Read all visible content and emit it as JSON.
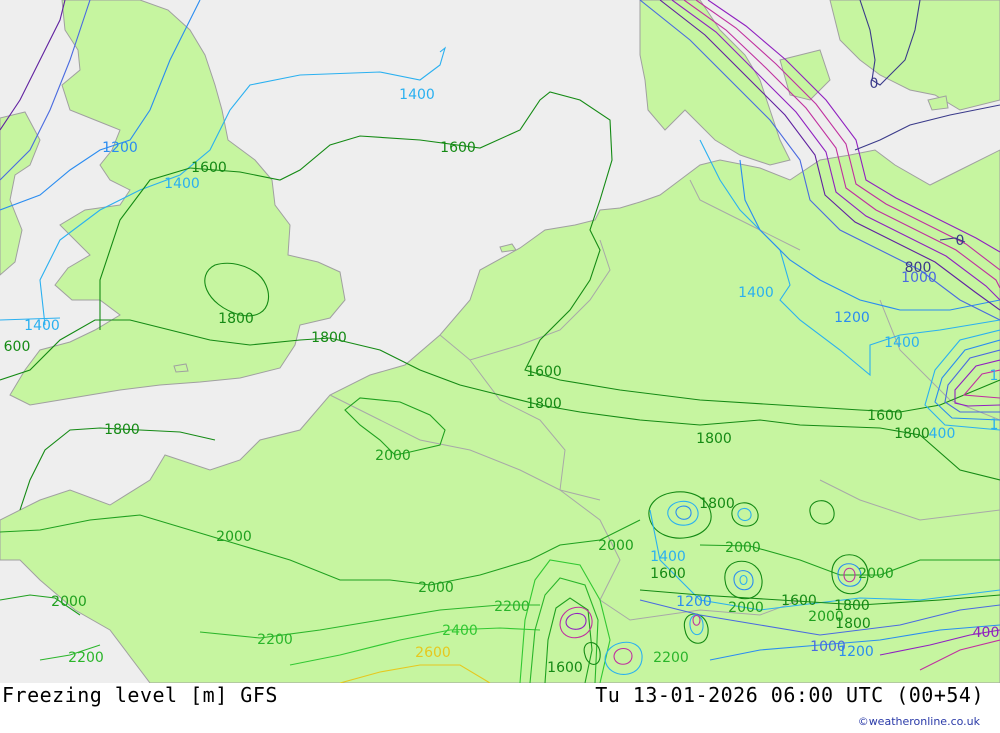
{
  "footer": {
    "title": "Freezing level [m] GFS",
    "datetime": "Tu 13-01-2026 06:00 UTC (00+54)",
    "credit": "©weatheronline.co.uk"
  },
  "colors": {
    "sea": "#eeeeee",
    "land": "#c6f5a0",
    "coastline": "#a0a0a0",
    "contour_1000": "#4a6ae0",
    "contour_1200": "#2a8cf0",
    "contour_1400": "#2ab0f0",
    "contour_1600": "#148a14",
    "contour_1800": "#148a14",
    "contour_2000": "#1fa01f",
    "contour_2200": "#2ab52a",
    "contour_2400": "#32c832",
    "contour_2600": "#e6c81e",
    "contour_low": "#9020c0",
    "contour_0": "#3a3a8a"
  },
  "contour_labels": [
    {
      "id": "l1400-a",
      "text": "1400",
      "color": "#2ab0f0"
    },
    {
      "id": "l1200-a",
      "text": "1200",
      "color": "#2a8cf0"
    },
    {
      "id": "l1400-b",
      "text": "1400",
      "color": "#2ab0f0"
    },
    {
      "id": "l1600-a",
      "text": "1600",
      "color": "#148a14"
    },
    {
      "id": "l1600-b",
      "text": "1600",
      "color": "#148a14"
    },
    {
      "id": "l1800-a",
      "text": "1800",
      "color": "#148a14"
    },
    {
      "id": "l1400-c",
      "text": "1400",
      "color": "#2ab0f0"
    },
    {
      "id": "l600",
      "text": "600",
      "color": "#148a14"
    },
    {
      "id": "l1800-b",
      "text": "1800",
      "color": "#148a14"
    },
    {
      "id": "l1800-c",
      "text": "1800",
      "color": "#148a14"
    },
    {
      "id": "l1600-c",
      "text": "1600",
      "color": "#148a14"
    },
    {
      "id": "l1800-d",
      "text": "1800",
      "color": "#148a14"
    },
    {
      "id": "l2000-a",
      "text": "2000",
      "color": "#1fa01f"
    },
    {
      "id": "l1800-e",
      "text": "1800",
      "color": "#148a14"
    },
    {
      "id": "l1600-d",
      "text": "1600",
      "color": "#148a14"
    },
    {
      "id": "l1800-f",
      "text": "1800",
      "color": "#148a14"
    },
    {
      "id": "l1400-d",
      "text": "1400",
      "color": "#2ab0f0"
    },
    {
      "id": "l1200-b",
      "text": "1200",
      "color": "#2a8cf0"
    },
    {
      "id": "l1400-e",
      "text": "1400",
      "color": "#2ab0f0"
    },
    {
      "id": "l1000",
      "text": "1000",
      "color": "#4a6ae0"
    },
    {
      "id": "l800",
      "text": "800",
      "color": "#3a3a8a"
    },
    {
      "id": "l0-a",
      "text": "0",
      "color": "#3a3a8a"
    },
    {
      "id": "l0-b",
      "text": "0",
      "color": "#3a3a8a"
    },
    {
      "id": "l2000-b",
      "text": "2000",
      "color": "#1fa01f"
    },
    {
      "id": "l2000-c",
      "text": "2000",
      "color": "#1fa01f"
    },
    {
      "id": "l2000-d",
      "text": "2000",
      "color": "#1fa01f"
    },
    {
      "id": "l2000-e",
      "text": "2000",
      "color": "#1fa01f"
    },
    {
      "id": "l1800-g",
      "text": "1800",
      "color": "#148a14"
    },
    {
      "id": "l2000-f",
      "text": "2000",
      "color": "#1fa01f"
    },
    {
      "id": "l1400-f",
      "text": "1400",
      "color": "#2ab0f0"
    },
    {
      "id": "l1600-e",
      "text": "1600",
      "color": "#148a14"
    },
    {
      "id": "l2000-g",
      "text": "2000",
      "color": "#1fa01f"
    },
    {
      "id": "l1200-c",
      "text": "1200",
      "color": "#2a8cf0"
    },
    {
      "id": "l2000-h",
      "text": "2000",
      "color": "#1fa01f"
    },
    {
      "id": "l1600-f",
      "text": "1600",
      "color": "#148a14"
    },
    {
      "id": "l1800-h",
      "text": "1800",
      "color": "#148a14"
    },
    {
      "id": "l2000-i",
      "text": "2000",
      "color": "#1fa01f"
    },
    {
      "id": "l1800-i",
      "text": "1800",
      "color": "#148a14"
    },
    {
      "id": "l2000-j",
      "text": "2000",
      "color": "#1fa01f"
    },
    {
      "id": "l2200-a",
      "text": "2200",
      "color": "#2ab52a"
    },
    {
      "id": "l2000-k",
      "text": "2000",
      "color": "#1fa01f"
    },
    {
      "id": "l2200-b",
      "text": "2200",
      "color": "#2ab52a"
    },
    {
      "id": "l2400",
      "text": "2400",
      "color": "#32c832"
    },
    {
      "id": "l2600",
      "text": "2600",
      "color": "#e6c81e"
    },
    {
      "id": "l2200-c",
      "text": "2200",
      "color": "#2ab52a"
    },
    {
      "id": "l1600-g",
      "text": "1600",
      "color": "#148a14"
    },
    {
      "id": "l2200-d",
      "text": "2200",
      "color": "#2ab52a"
    },
    {
      "id": "l1000-b",
      "text": "1000",
      "color": "#4a6ae0"
    },
    {
      "id": "l1200-d",
      "text": "1200",
      "color": "#2a8cf0"
    },
    {
      "id": "l400",
      "text": "400",
      "color": "#9020c0"
    },
    {
      "id": "l1-a",
      "text": "1",
      "color": "#2ab0f0"
    },
    {
      "id": "l1-b",
      "text": "1",
      "color": "#2ab0f0"
    },
    {
      "id": "l400-b",
      "text": "400",
      "color": "#2ab0f0"
    }
  ]
}
